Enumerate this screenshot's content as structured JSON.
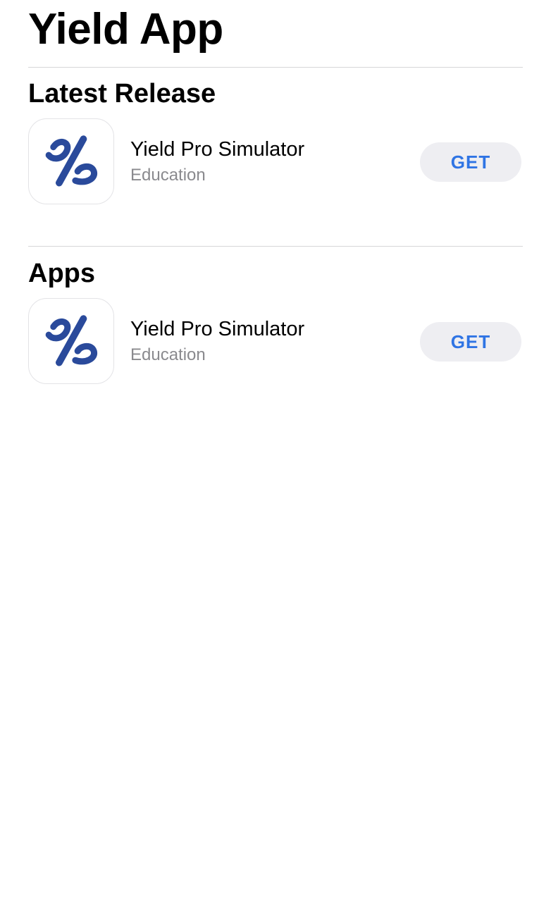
{
  "header": {
    "title": "Yield App"
  },
  "sections": [
    {
      "title": "Latest Release",
      "apps": [
        {
          "name": "Yield Pro Simulator",
          "category": "Education",
          "action": "GET",
          "icon": "yield-logo-icon"
        }
      ]
    },
    {
      "title": "Apps",
      "apps": [
        {
          "name": "Yield Pro Simulator",
          "category": "Education",
          "action": "GET",
          "icon": "yield-logo-icon"
        }
      ]
    }
  ],
  "colors": {
    "accent": "#2f74e4",
    "logo": "#2a4a9b",
    "secondary_text": "#8a8a8e",
    "button_bg": "#eeeef2"
  }
}
